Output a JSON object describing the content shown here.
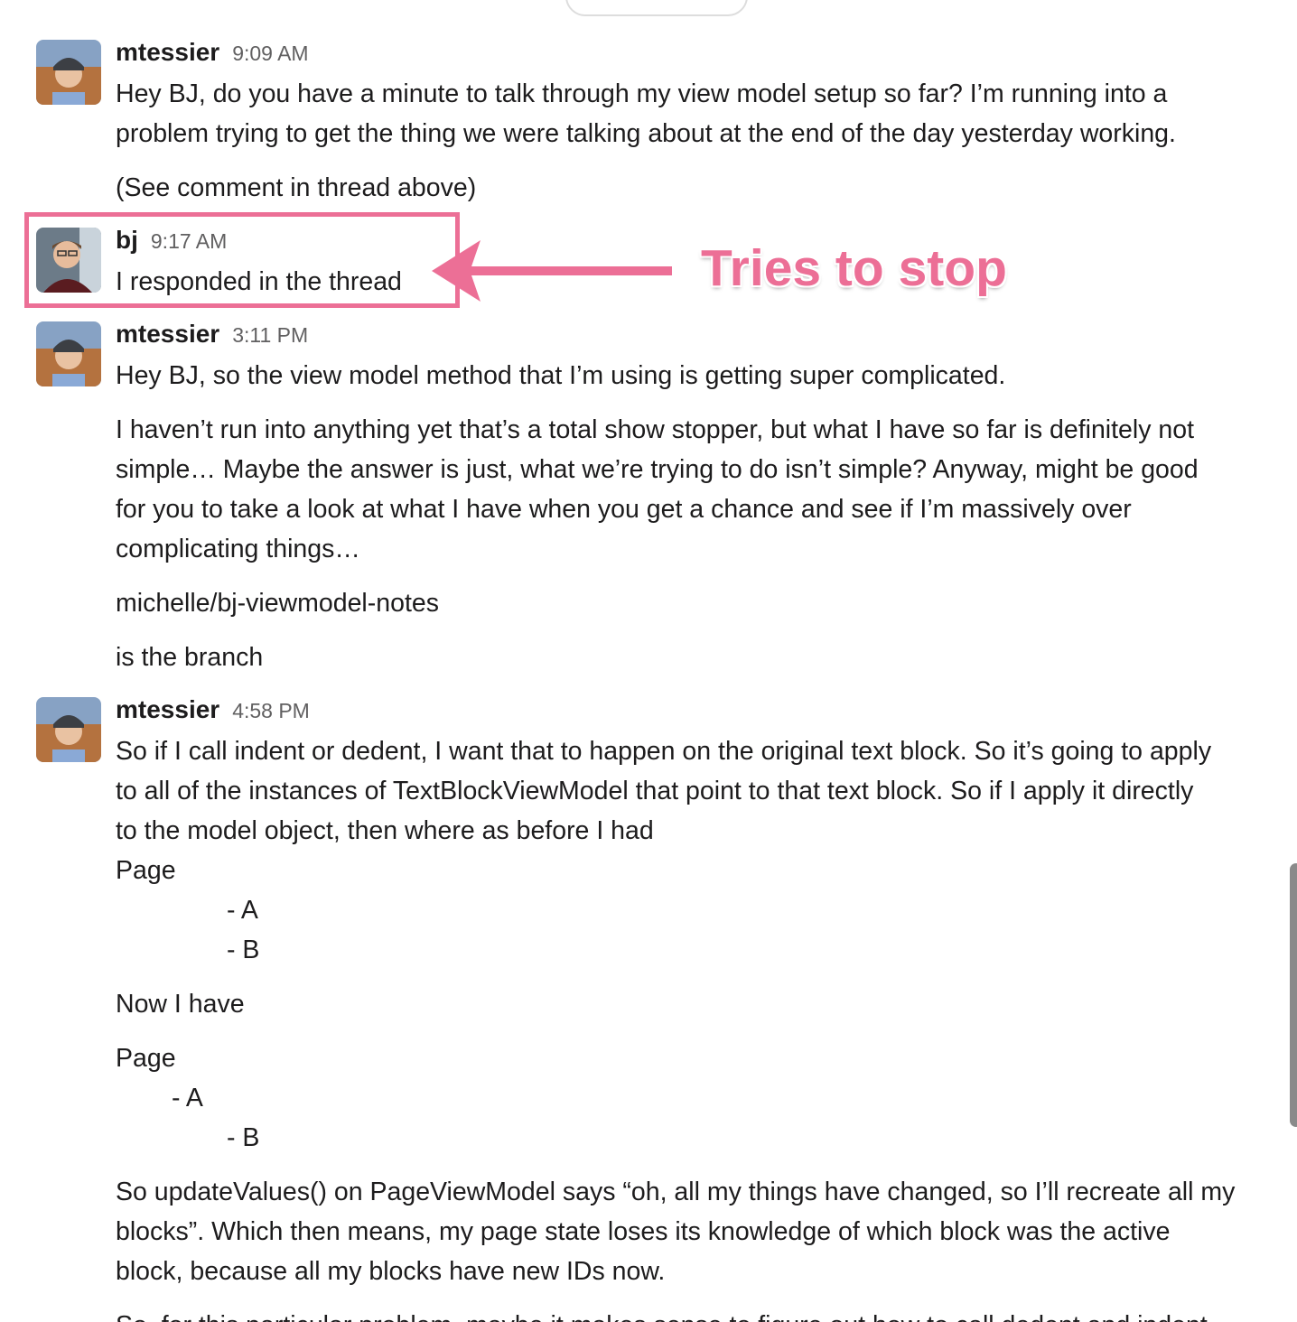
{
  "annotation": {
    "label": "Tries to stop",
    "color": "#ec6f96"
  },
  "messages": [
    {
      "author": "mtessier",
      "time": "9:09 AM",
      "lines": [
        "Hey BJ, do you have a minute to talk through my view model setup so far? I’m running into a",
        "problem trying to get the thing we were talking about at the end of the day yesterday working.",
        "(See comment in thread above)"
      ]
    },
    {
      "author": "bj",
      "time": "9:17 AM",
      "lines": [
        "I responded in the thread"
      ]
    },
    {
      "author": "mtessier",
      "time": "3:11 PM",
      "lines": [
        "Hey BJ, so the view model method that I’m using is getting super complicated.",
        "I haven’t run into anything yet that’s a total show stopper, but what I have so far is definitely not",
        "simple… Maybe the answer is just, what we’re trying to do isn’t simple? Anyway, might be good",
        "for you to take a look at what I have when you get a chance and see if I’m massively over",
        "complicating things…",
        "michelle/bj-viewmodel-notes",
        "is the branch"
      ]
    },
    {
      "author": "mtessier",
      "time": "4:58 PM",
      "lines": [
        "So if I call indent or dedent, I want that to happen on the original text block. So it’s going to apply",
        "to all of the instances of TextBlockViewModel that point to that text block. So if I apply it directly",
        "to the model object, then where as before I had",
        "Page",
        "- A",
        "- B",
        "Now I have",
        "Page",
        "- A",
        "- B",
        "So updateValues() on PageViewModel says “oh, all my things have changed, so I’ll recreate all my",
        "blocks”. Which then means, my page state loses its knowledge of which block was the active",
        "block, because all my blocks have new IDs now.",
        "So, for this particular problem, maybe it makes sense to figure out how to call dedent and indent"
      ]
    }
  ]
}
